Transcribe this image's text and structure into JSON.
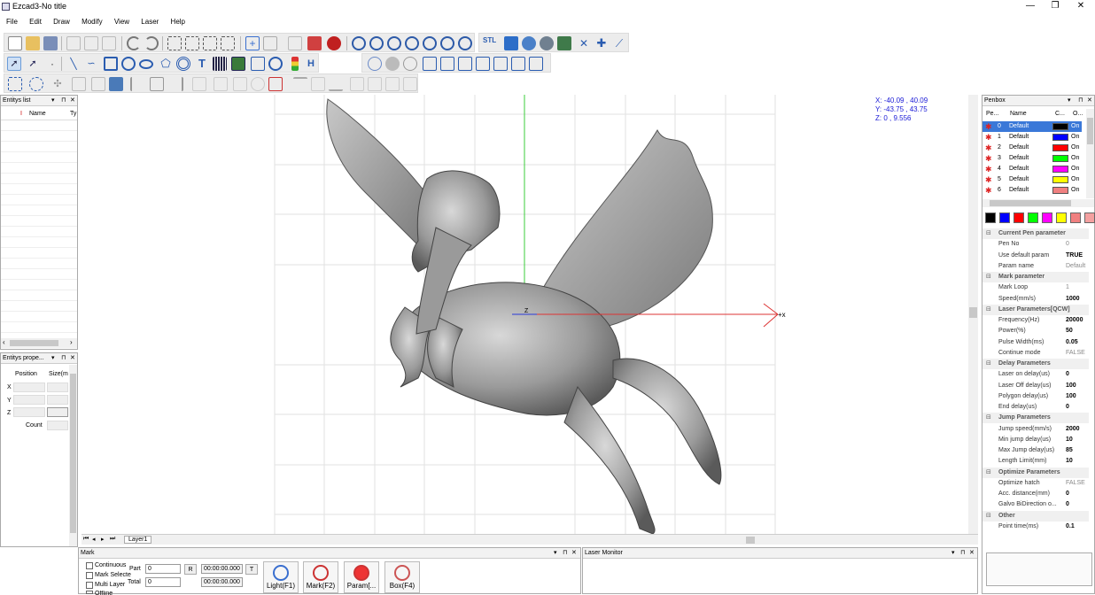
{
  "app": {
    "title": "Ezcad3-No title"
  },
  "window": {
    "minimize": "—",
    "maximize": "❐",
    "close": "✕"
  },
  "menu": [
    "File",
    "Edit",
    "Draw",
    "Modify",
    "View",
    "Laser",
    "Help"
  ],
  "toolbar": {
    "stl_label": "STL",
    "text_tool_label": "T",
    "hatch_label": "H"
  },
  "entity_list": {
    "title": "Entitys list",
    "columns": [
      "I",
      "Name",
      "Ty"
    ]
  },
  "entity_props": {
    "title": "Entitys prope...",
    "position_label": "Position",
    "size_label": "Size(m",
    "x": "X",
    "y": "Y",
    "z": "Z",
    "count_label": "Count"
  },
  "coords": {
    "x": "X: -40.09 , 40.09",
    "y": "Y: -43.75 , 43.75",
    "z": "Z: 0 , 9.556"
  },
  "canvas": {
    "layer_tab": "Layer1",
    "origin_label": "Z",
    "axis_x_label": "+x",
    "image_icon": "pegasus-relief-image"
  },
  "penbox": {
    "title": "Penbox",
    "columns": [
      "Pe...",
      "Name",
      "C...",
      "O..."
    ],
    "pens": [
      {
        "no": "0",
        "name": "Default",
        "color": "#000000",
        "on": "On"
      },
      {
        "no": "1",
        "name": "Default",
        "color": "#0000ff",
        "on": "On"
      },
      {
        "no": "2",
        "name": "Default",
        "color": "#ff0000",
        "on": "On"
      },
      {
        "no": "3",
        "name": "Default",
        "color": "#00ff00",
        "on": "On"
      },
      {
        "no": "4",
        "name": "Default",
        "color": "#ff00ff",
        "on": "On"
      },
      {
        "no": "5",
        "name": "Default",
        "color": "#ffff00",
        "on": "On"
      },
      {
        "no": "6",
        "name": "Default",
        "color": "#f08080",
        "on": "On"
      }
    ],
    "swatches": [
      "#000000",
      "#0000ff",
      "#ff0000",
      "#00ff00",
      "#ff00ff",
      "#ffff00",
      "#f08080",
      "#f4a0a0",
      "#8b0000"
    ]
  },
  "params": {
    "current_pen": {
      "title": "Current Pen parameter",
      "pen_no_label": "Pen No",
      "pen_no": "0",
      "use_default_label": "Use default param",
      "use_default": "TRUE",
      "param_name_label": "Param name",
      "param_name": "Default"
    },
    "mark": {
      "title": "Mark parameter",
      "loop_label": "Mark Loop",
      "loop": "1",
      "speed_label": "Speed(mm/s)",
      "speed": "1000"
    },
    "laser": {
      "title": "Laser Parameters[QCW]",
      "freq_label": "Frequency(Hz)",
      "freq": "20000",
      "power_label": "Power(%)",
      "power": "50",
      "pulse_label": "Pulse Width(ms)",
      "pulse": "0.05",
      "cont_label": "Continue mode",
      "cont": "FALSE"
    },
    "delay": {
      "title": "Delay Parameters",
      "on_label": "Laser on delay(us)",
      "on": "0",
      "off_label": "Laser Off delay(us)",
      "off": "100",
      "poly_label": "Polygon delay(us)",
      "poly": "100",
      "end_label": "End delay(us)",
      "end": "0"
    },
    "jump": {
      "title": "Jump Parameters",
      "speed_label": "Jump speed(mm/s)",
      "speed": "2000",
      "min_label": "Min jump delay(us)",
      "min": "10",
      "max_label": "Max Jump delay(us)",
      "max": "85",
      "limit_label": "Length Limit(mm)",
      "limit": "10"
    },
    "optimize": {
      "title": "Optimize Parameters",
      "hatch_label": "Optimize hatch",
      "hatch": "FALSE",
      "acc_label": "Acc. distance(mm)",
      "acc": "0",
      "galvo_label": "Galvo BiDirection o...",
      "galvo": "0"
    },
    "other": {
      "title": "Other",
      "point_label": "Point time(ms)",
      "point": "0.1"
    }
  },
  "mark_panel": {
    "title": "Mark",
    "continuous": "Continuous",
    "mark_selected": "Mark Selecte",
    "multi_layer": "Multi Layer",
    "offline": "Offline",
    "part_label": "Part",
    "part_value": "0",
    "total_label": "Total",
    "total_value": "0",
    "time1": "00:00:00.000",
    "time2": "00:00:00.000",
    "r_button": "R",
    "t_button": "T",
    "light": "Light(F1)",
    "mark": "Mark(F2)",
    "param": "Param[...",
    "box": "Box(F4)"
  },
  "laser_monitor": {
    "title": "Laser Monitor"
  }
}
